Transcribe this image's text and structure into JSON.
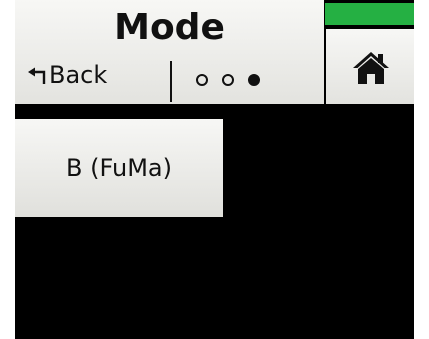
{
  "header": {
    "title": "Mode",
    "back_label": "Back",
    "page_indicator": {
      "total": 3,
      "current": 3
    }
  },
  "icons": {
    "back": "back-arrow-icon",
    "home": "home-icon"
  },
  "mode_options": [
    {
      "label": "B (FuMa)"
    }
  ],
  "colors": {
    "status_bar": "#25b043",
    "screen_background": "#000000",
    "button_background": "#eeeeeb",
    "text": "#111111"
  }
}
